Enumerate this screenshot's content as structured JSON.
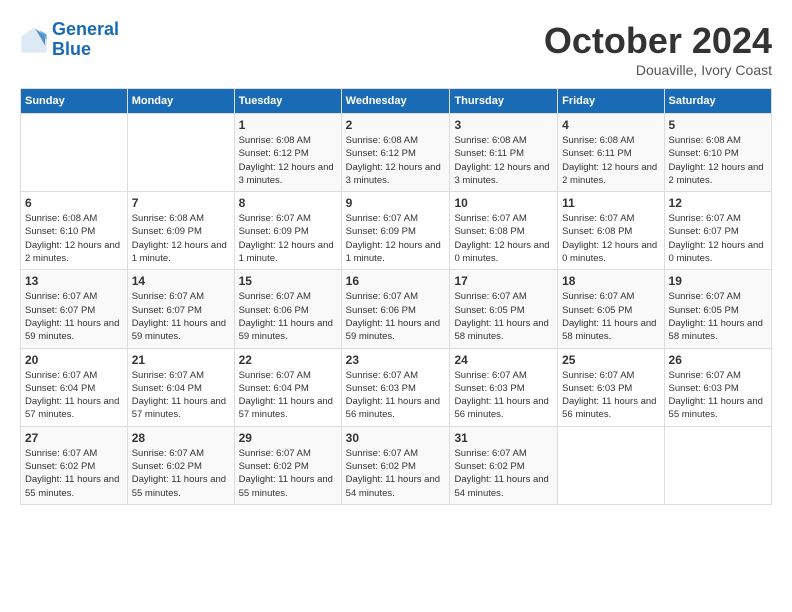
{
  "header": {
    "logo_line1": "General",
    "logo_line2": "Blue",
    "month": "October 2024",
    "location": "Douaville, Ivory Coast"
  },
  "days_of_week": [
    "Sunday",
    "Monday",
    "Tuesday",
    "Wednesday",
    "Thursday",
    "Friday",
    "Saturday"
  ],
  "weeks": [
    [
      {
        "day": "",
        "info": ""
      },
      {
        "day": "",
        "info": ""
      },
      {
        "day": "1",
        "info": "Sunrise: 6:08 AM\nSunset: 6:12 PM\nDaylight: 12 hours and 3 minutes."
      },
      {
        "day": "2",
        "info": "Sunrise: 6:08 AM\nSunset: 6:12 PM\nDaylight: 12 hours and 3 minutes."
      },
      {
        "day": "3",
        "info": "Sunrise: 6:08 AM\nSunset: 6:11 PM\nDaylight: 12 hours and 3 minutes."
      },
      {
        "day": "4",
        "info": "Sunrise: 6:08 AM\nSunset: 6:11 PM\nDaylight: 12 hours and 2 minutes."
      },
      {
        "day": "5",
        "info": "Sunrise: 6:08 AM\nSunset: 6:10 PM\nDaylight: 12 hours and 2 minutes."
      }
    ],
    [
      {
        "day": "6",
        "info": "Sunrise: 6:08 AM\nSunset: 6:10 PM\nDaylight: 12 hours and 2 minutes."
      },
      {
        "day": "7",
        "info": "Sunrise: 6:08 AM\nSunset: 6:09 PM\nDaylight: 12 hours and 1 minute."
      },
      {
        "day": "8",
        "info": "Sunrise: 6:07 AM\nSunset: 6:09 PM\nDaylight: 12 hours and 1 minute."
      },
      {
        "day": "9",
        "info": "Sunrise: 6:07 AM\nSunset: 6:09 PM\nDaylight: 12 hours and 1 minute."
      },
      {
        "day": "10",
        "info": "Sunrise: 6:07 AM\nSunset: 6:08 PM\nDaylight: 12 hours and 0 minutes."
      },
      {
        "day": "11",
        "info": "Sunrise: 6:07 AM\nSunset: 6:08 PM\nDaylight: 12 hours and 0 minutes."
      },
      {
        "day": "12",
        "info": "Sunrise: 6:07 AM\nSunset: 6:07 PM\nDaylight: 12 hours and 0 minutes."
      }
    ],
    [
      {
        "day": "13",
        "info": "Sunrise: 6:07 AM\nSunset: 6:07 PM\nDaylight: 11 hours and 59 minutes."
      },
      {
        "day": "14",
        "info": "Sunrise: 6:07 AM\nSunset: 6:07 PM\nDaylight: 11 hours and 59 minutes."
      },
      {
        "day": "15",
        "info": "Sunrise: 6:07 AM\nSunset: 6:06 PM\nDaylight: 11 hours and 59 minutes."
      },
      {
        "day": "16",
        "info": "Sunrise: 6:07 AM\nSunset: 6:06 PM\nDaylight: 11 hours and 59 minutes."
      },
      {
        "day": "17",
        "info": "Sunrise: 6:07 AM\nSunset: 6:05 PM\nDaylight: 11 hours and 58 minutes."
      },
      {
        "day": "18",
        "info": "Sunrise: 6:07 AM\nSunset: 6:05 PM\nDaylight: 11 hours and 58 minutes."
      },
      {
        "day": "19",
        "info": "Sunrise: 6:07 AM\nSunset: 6:05 PM\nDaylight: 11 hours and 58 minutes."
      }
    ],
    [
      {
        "day": "20",
        "info": "Sunrise: 6:07 AM\nSunset: 6:04 PM\nDaylight: 11 hours and 57 minutes."
      },
      {
        "day": "21",
        "info": "Sunrise: 6:07 AM\nSunset: 6:04 PM\nDaylight: 11 hours and 57 minutes."
      },
      {
        "day": "22",
        "info": "Sunrise: 6:07 AM\nSunset: 6:04 PM\nDaylight: 11 hours and 57 minutes."
      },
      {
        "day": "23",
        "info": "Sunrise: 6:07 AM\nSunset: 6:03 PM\nDaylight: 11 hours and 56 minutes."
      },
      {
        "day": "24",
        "info": "Sunrise: 6:07 AM\nSunset: 6:03 PM\nDaylight: 11 hours and 56 minutes."
      },
      {
        "day": "25",
        "info": "Sunrise: 6:07 AM\nSunset: 6:03 PM\nDaylight: 11 hours and 56 minutes."
      },
      {
        "day": "26",
        "info": "Sunrise: 6:07 AM\nSunset: 6:03 PM\nDaylight: 11 hours and 55 minutes."
      }
    ],
    [
      {
        "day": "27",
        "info": "Sunrise: 6:07 AM\nSunset: 6:02 PM\nDaylight: 11 hours and 55 minutes."
      },
      {
        "day": "28",
        "info": "Sunrise: 6:07 AM\nSunset: 6:02 PM\nDaylight: 11 hours and 55 minutes."
      },
      {
        "day": "29",
        "info": "Sunrise: 6:07 AM\nSunset: 6:02 PM\nDaylight: 11 hours and 55 minutes."
      },
      {
        "day": "30",
        "info": "Sunrise: 6:07 AM\nSunset: 6:02 PM\nDaylight: 11 hours and 54 minutes."
      },
      {
        "day": "31",
        "info": "Sunrise: 6:07 AM\nSunset: 6:02 PM\nDaylight: 11 hours and 54 minutes."
      },
      {
        "day": "",
        "info": ""
      },
      {
        "day": "",
        "info": ""
      }
    ]
  ]
}
